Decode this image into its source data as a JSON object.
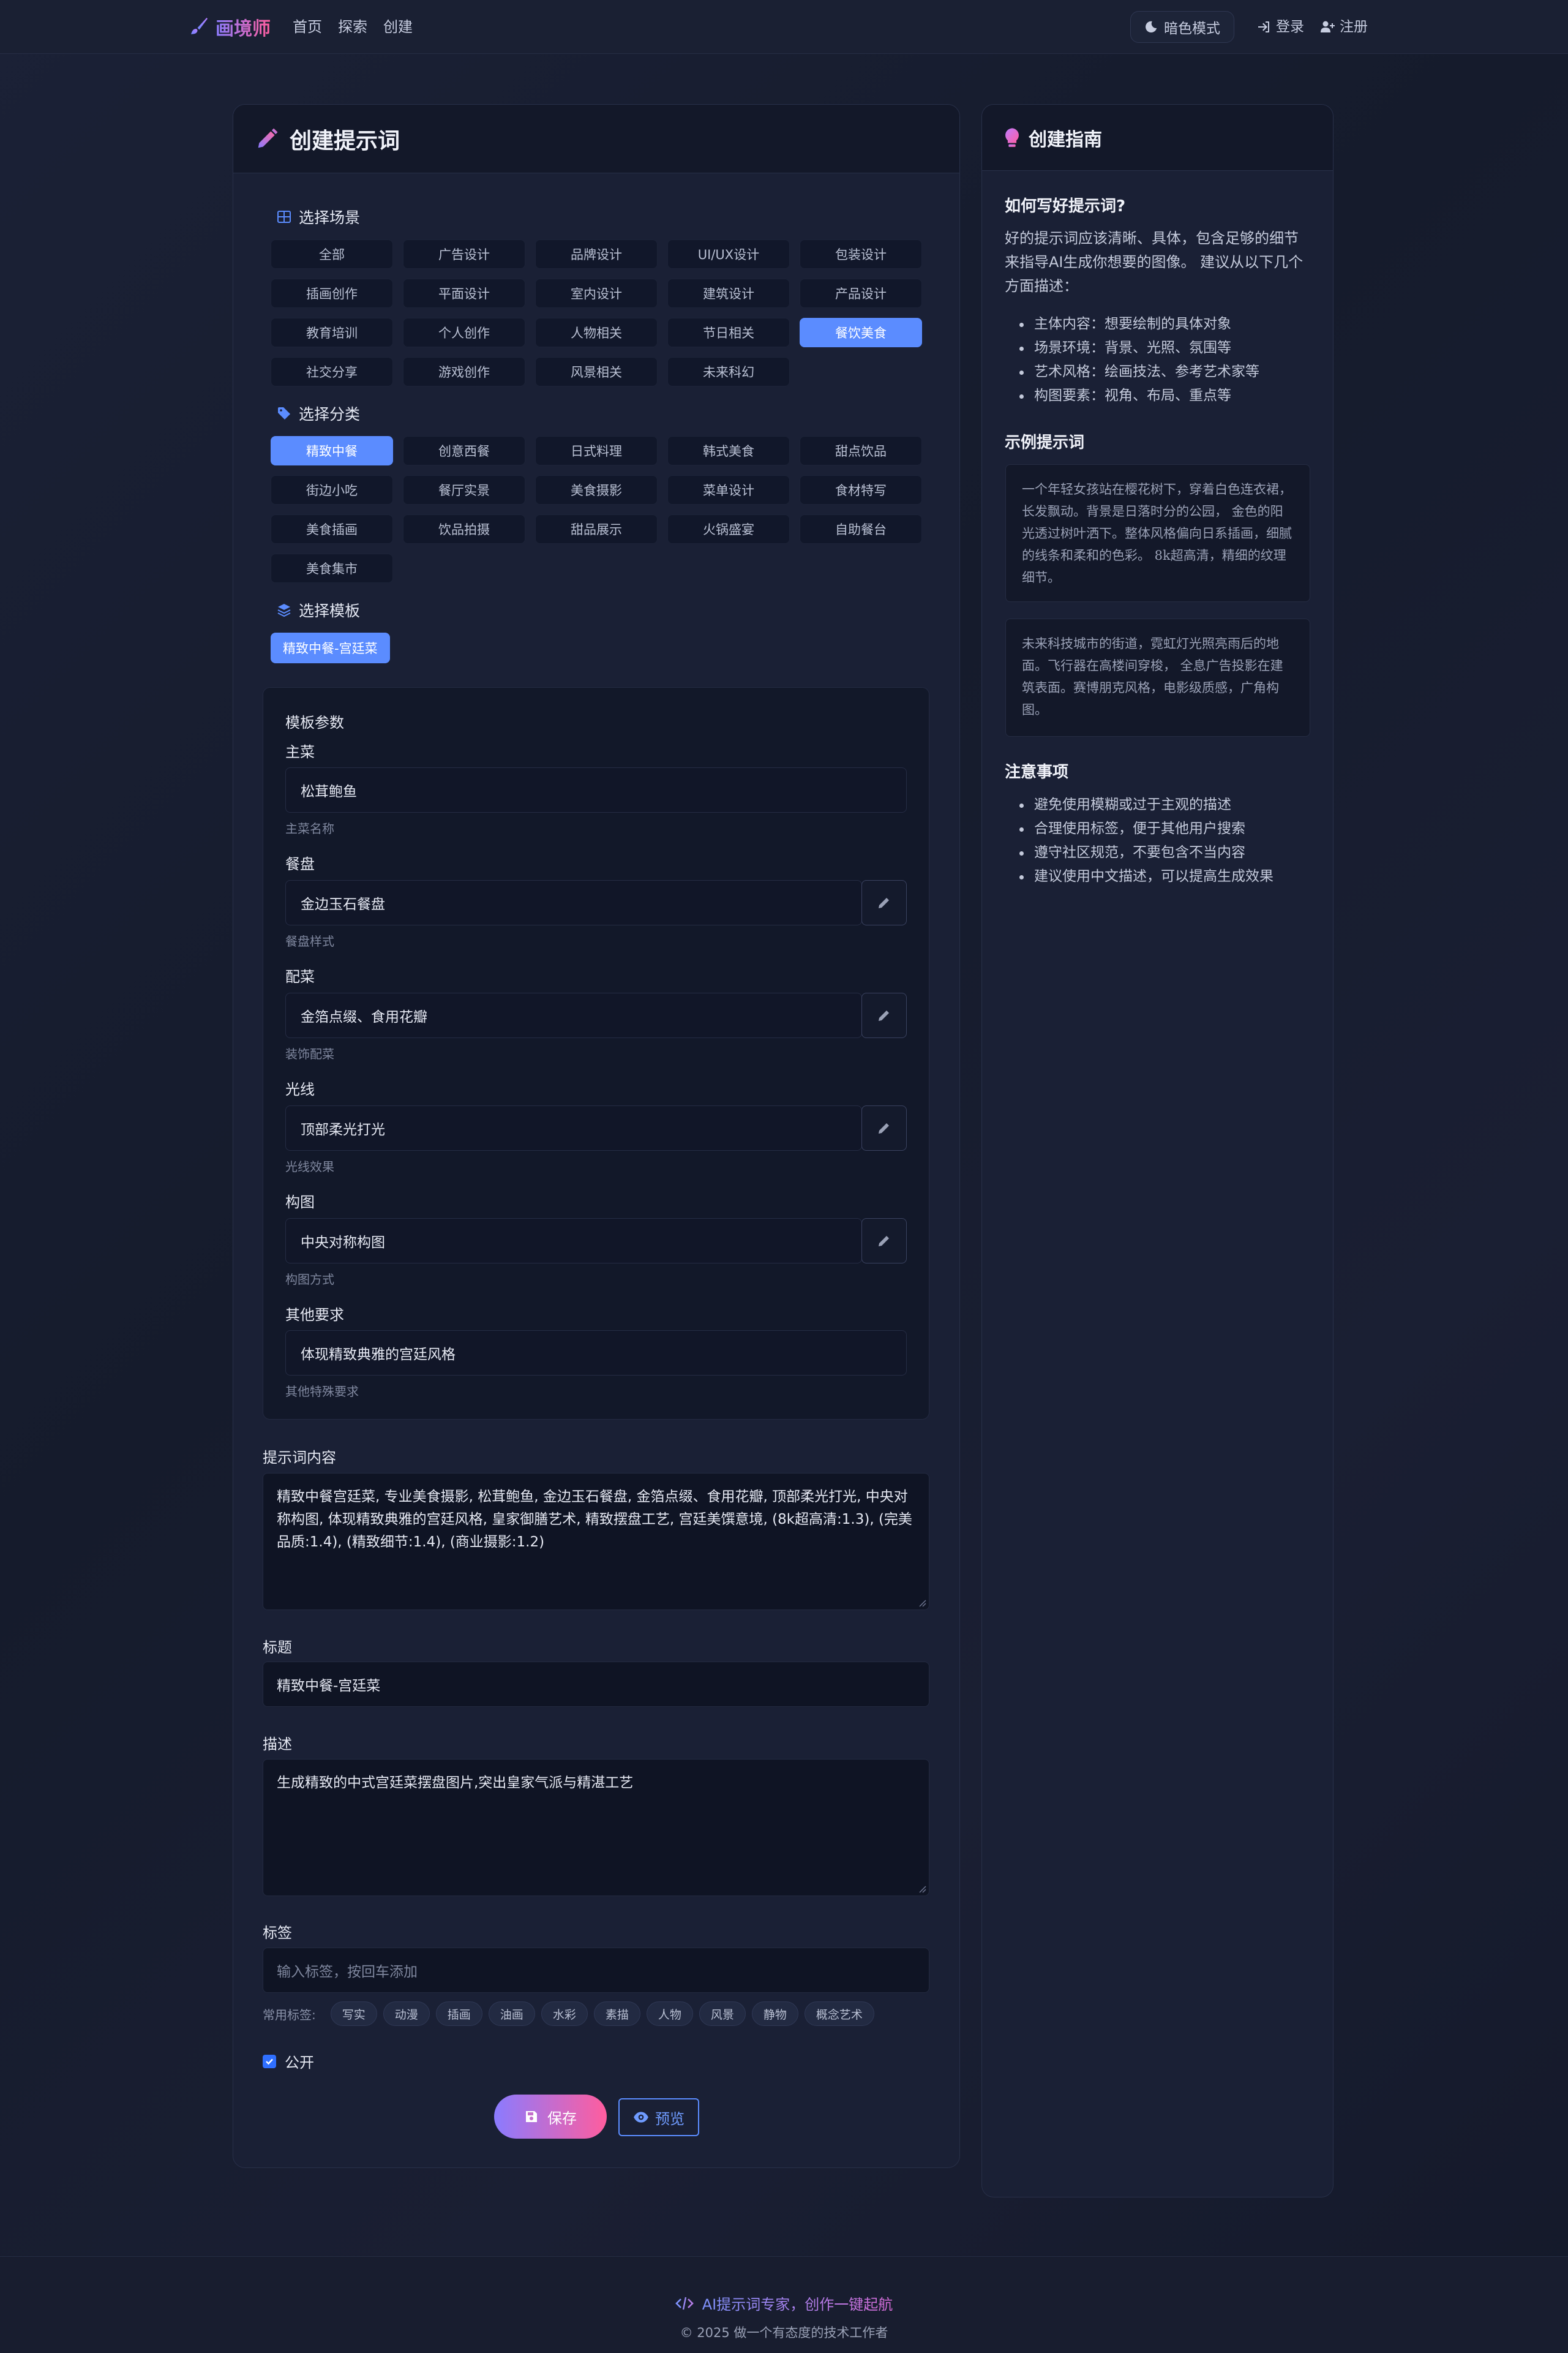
{
  "nav": {
    "brand": "画境师",
    "links": [
      "首页",
      "探索",
      "创建"
    ],
    "dark_mode": "暗色模式",
    "login": "登录",
    "register": "注册"
  },
  "form": {
    "title": "创建提示词",
    "scene_label": "选择场景",
    "scenes": [
      "全部",
      "广告设计",
      "品牌设计",
      "UI/UX设计",
      "包装设计",
      "插画创作",
      "平面设计",
      "室内设计",
      "建筑设计",
      "产品设计",
      "教育培训",
      "个人创作",
      "人物相关",
      "节日相关",
      "餐饮美食",
      "社交分享",
      "游戏创作",
      "风景相关",
      "未来科幻"
    ],
    "scene_active": "餐饮美食",
    "category_label": "选择分类",
    "categories": [
      "精致中餐",
      "创意西餐",
      "日式料理",
      "韩式美食",
      "甜点饮品",
      "街边小吃",
      "餐厅实景",
      "美食摄影",
      "菜单设计",
      "食材特写",
      "美食插画",
      "饮品拍摄",
      "甜品展示",
      "火锅盛宴",
      "自助餐台",
      "美食集市"
    ],
    "category_active": "精致中餐",
    "template_label": "选择模板",
    "template": "精致中餐-宫廷菜",
    "params_title": "模板参数",
    "params": [
      {
        "label": "主菜",
        "value": "松茸鲍鱼",
        "help": "主菜名称"
      },
      {
        "label": "餐盘",
        "value": "金边玉石餐盘",
        "help": "餐盘样式"
      },
      {
        "label": "配菜",
        "value": "金箔点缀、食用花瓣",
        "help": "装饰配菜"
      },
      {
        "label": "光线",
        "value": "顶部柔光打光",
        "help": "光线效果"
      },
      {
        "label": "构图",
        "value": "中央对称构图",
        "help": "构图方式"
      },
      {
        "label": "其他要求",
        "value": "体现精致典雅的宫廷风格",
        "help": "其他特殊要求"
      }
    ],
    "content_label": "提示词内容",
    "content": "精致中餐宫廷菜, 专业美食摄影, 松茸鲍鱼, 金边玉石餐盘, 金箔点缀、食用花瓣, 顶部柔光打光, 中央对称构图, 体现精致典雅的宫廷风格, 皇家御膳艺术, 精致摆盘工艺, 宫廷美馔意境, (8k超高清:1.3), (完美品质:1.4), (精致细节:1.4), (商业摄影:1.2)",
    "title_label": "标题",
    "title_value": "精致中餐-宫廷菜",
    "desc_label": "描述",
    "desc_value": "生成精致的中式宫廷菜摆盘图片,突出皇家气派与精湛工艺",
    "tags_label": "标签",
    "tags_placeholder": "输入标签，按回车添加",
    "common_tags_label": "常用标签:",
    "common_tags": [
      "写实",
      "动漫",
      "插画",
      "油画",
      "水彩",
      "素描",
      "人物",
      "风景",
      "静物",
      "概念艺术"
    ],
    "public_label": "公开",
    "save": "保存",
    "preview": "预览"
  },
  "guide": {
    "title": "创建指南",
    "how_title": "如何写好提示词?",
    "how_text": "好的提示词应该清晰、具体，包含足够的细节来指导AI生成你想要的图像。 建议从以下几个方面描述：",
    "how_items": [
      "主体内容：想要绘制的具体对象",
      "场景环境：背景、光照、氛围等",
      "艺术风格：绘画技法、参考艺术家等",
      "构图要素：视角、布局、重点等"
    ],
    "example_title": "示例提示词",
    "examples": [
      "一个年轻女孩站在樱花树下，穿着白色连衣裙，长发飘动。背景是日落时分的公园，  金色的阳光透过树叶洒下。整体风格偏向日系插画，细腻的线条和柔和的色彩。 8k超高清，精细的纹理细节。",
      "未来科技城市的街道，霓虹灯光照亮雨后的地面。飞行器在高楼间穿梭，  全息广告投影在建筑表面。赛博朋克风格，电影级质感，广角构图。"
    ],
    "notes_title": "注意事项",
    "notes": [
      "避免使用模糊或过于主观的描述",
      "合理使用标签，便于其他用户搜索",
      "遵守社区规范，不要包含不当内容",
      "建议使用中文描述，可以提高生成效果"
    ]
  },
  "footer": {
    "tagline": "AI提示词专家，创作一键起航",
    "copyright": "© 2025 做一个有态度的技术工作者"
  },
  "colors": {
    "accent": "#5b8cff",
    "brand_gradient_start": "#8b7cff",
    "brand_gradient_end": "#ff5d9e",
    "background": "#171c2e"
  }
}
